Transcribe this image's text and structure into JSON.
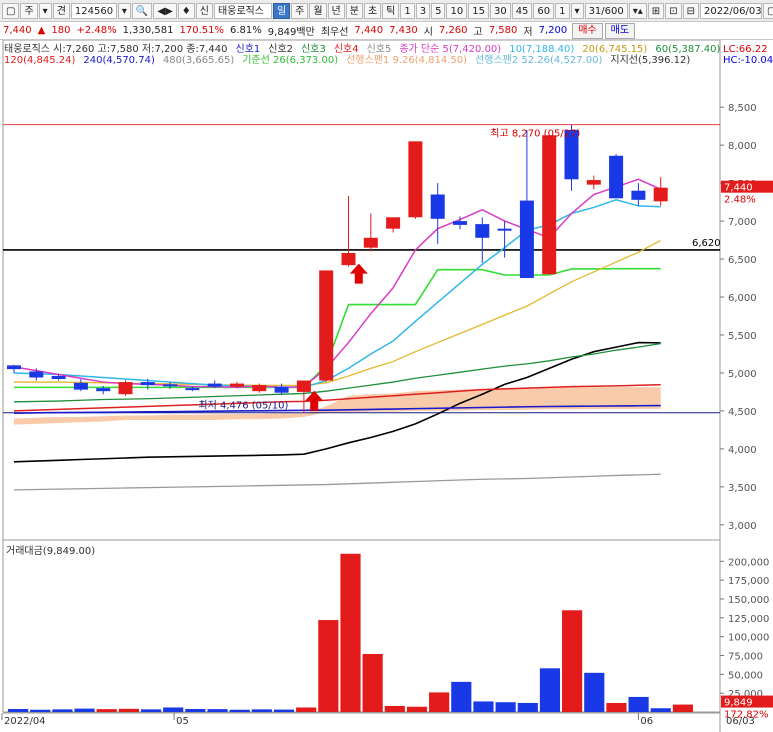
{
  "toolbar": {
    "items": [
      "▢",
      "주",
      "▾",
      "견",
      "124560",
      "▾",
      "🔍",
      "◀▶",
      "♦",
      "신",
      "태웅로직스",
      "일",
      "주",
      "월",
      "년",
      "분",
      "초",
      "틱",
      "1",
      "3",
      "5",
      "10",
      "15",
      "30",
      "45",
      "60",
      "1",
      "▾",
      "31/600",
      "▾▴",
      "⊞",
      "⊡",
      "⊟",
      "2022/06/03",
      "▢"
    ],
    "active": "일"
  },
  "quote": {
    "price": "7,440",
    "change_arrow": "▲",
    "change": "180",
    "change_pct": "+2.48%",
    "volume": "1,330,581",
    "vol_ratio": "170.51%",
    "turnover_pct": "6.81%",
    "amount_label": "9,849백만",
    "priority_label": "최우선",
    "ask": "7,440",
    "bid": "7,430",
    "open_label": "시",
    "open": "7,260",
    "high_label": "고",
    "high": "7,580",
    "low_label": "저",
    "low": "7,200",
    "buy_btn": "매수",
    "sell_btn": "매도"
  },
  "colors": {
    "up": "#e31b1b",
    "down": "#1a39e6",
    "ma5": "#d93cc3",
    "ma10": "#2fb7ea",
    "ma20": "#e3b82c",
    "ma60": "#1f8f3a",
    "ma120": "#e02020",
    "ma240": "#1a1acc",
    "ma480": "#9a9a9a",
    "kijun": "#33dd33",
    "cloud": "#f7b98f",
    "lagging": "#000000"
  },
  "legend": {
    "row1": [
      {
        "text": "태웅로직스 시:7,260 고:7,580 저:7,200 종:7,440",
        "color": "#333333"
      },
      {
        "text": "신호1",
        "color": "#1a1acc"
      },
      {
        "text": "신호2",
        "color": "#333333"
      },
      {
        "text": "신호3",
        "color": "#1f8f3a"
      },
      {
        "text": "신호4",
        "color": "#e31b1b"
      },
      {
        "text": "신호5",
        "color": "#888888"
      },
      {
        "text": "종가 단순 5(7,420.00)",
        "color": "#d93cc3"
      },
      {
        "text": "10(7,188.40)",
        "color": "#2fb7ea"
      },
      {
        "text": "20(6,745.15)",
        "color": "#c99a10"
      },
      {
        "text": "60(5,387.40)",
        "color": "#1f8f3a"
      }
    ],
    "row2": [
      {
        "text": "120(4,845.24)",
        "color": "#e31b1b"
      },
      {
        "text": "240(4,570.74)",
        "color": "#1a1acc"
      },
      {
        "text": "480(3,665.65)",
        "color": "#888888"
      },
      {
        "text": "기준선 26(6,373.00)",
        "color": "#33bb33"
      },
      {
        "text": "선행스팬1 9.26(4,814.50)",
        "color": "#f0a070"
      },
      {
        "text": "선행스팬2 52.26(4,527.00)",
        "color": "#66b8d8"
      },
      {
        "text": "지지선(5,396.12)",
        "color": "#333333"
      }
    ],
    "lc": "LC:66.22",
    "hc": "HC:-10.04"
  },
  "annotations": {
    "high": "최고 8,270 (05/27)",
    "low": "최저 4,476 (05/10)",
    "support_value": "6,620",
    "last_price": "7,440",
    "last_pct": "2.48%",
    "volume_title": "거래대금(9,849.00)",
    "volume_last": "9,849",
    "volume_pct": "172.82%",
    "date_end": "06/03"
  },
  "chart_data": {
    "type": "candlestick",
    "dates_visible": [
      "2022/04",
      "05",
      "06"
    ],
    "price_axis": {
      "ticks": [
        3000,
        3500,
        4000,
        4500,
        5000,
        5500,
        6000,
        6500,
        7000,
        7500,
        8000,
        8500
      ],
      "ylim": [
        2800,
        8700
      ]
    },
    "volume_axis": {
      "ticks": [
        25000,
        50000,
        75000,
        100000,
        125000,
        150000,
        175000,
        200000
      ],
      "ylim": [
        0,
        215000
      ]
    },
    "candles": [
      {
        "o": 5100,
        "h": 5110,
        "l": 5000,
        "c": 5050,
        "dir": "down"
      },
      {
        "o": 5020,
        "h": 5060,
        "l": 4900,
        "c": 4940,
        "dir": "down"
      },
      {
        "o": 4960,
        "h": 4990,
        "l": 4900,
        "c": 4920,
        "dir": "down"
      },
      {
        "o": 4870,
        "h": 4920,
        "l": 4760,
        "c": 4780,
        "dir": "down"
      },
      {
        "o": 4800,
        "h": 4830,
        "l": 4720,
        "c": 4760,
        "dir": "down"
      },
      {
        "o": 4720,
        "h": 4900,
        "l": 4700,
        "c": 4880,
        "dir": "up"
      },
      {
        "o": 4880,
        "h": 4920,
        "l": 4780,
        "c": 4840,
        "dir": "down"
      },
      {
        "o": 4850,
        "h": 4880,
        "l": 4790,
        "c": 4830,
        "dir": "down"
      },
      {
        "o": 4800,
        "h": 4820,
        "l": 4760,
        "c": 4780,
        "dir": "down"
      },
      {
        "o": 4860,
        "h": 4900,
        "l": 4800,
        "c": 4820,
        "dir": "down"
      },
      {
        "o": 4820,
        "h": 4880,
        "l": 4800,
        "c": 4860,
        "dir": "up"
      },
      {
        "o": 4760,
        "h": 4860,
        "l": 4740,
        "c": 4840,
        "dir": "up"
      },
      {
        "o": 4820,
        "h": 4860,
        "l": 4710,
        "c": 4740,
        "dir": "down"
      },
      {
        "o": 4750,
        "h": 4890,
        "l": 4476,
        "c": 4900,
        "dir": "up"
      },
      {
        "o": 4900,
        "h": 6350,
        "l": 4880,
        "c": 6350,
        "dir": "up"
      },
      {
        "o": 6420,
        "h": 7330,
        "l": 6400,
        "c": 6580,
        "dir": "up"
      },
      {
        "o": 6650,
        "h": 7100,
        "l": 6600,
        "c": 6780,
        "dir": "up"
      },
      {
        "o": 6900,
        "h": 7020,
        "l": 6850,
        "c": 7050,
        "dir": "up"
      },
      {
        "o": 7050,
        "h": 8050,
        "l": 7030,
        "c": 8050,
        "dir": "up"
      },
      {
        "o": 7350,
        "h": 7500,
        "l": 6700,
        "c": 7030,
        "dir": "down"
      },
      {
        "o": 7000,
        "h": 7060,
        "l": 6890,
        "c": 6950,
        "dir": "down"
      },
      {
        "o": 6960,
        "h": 7050,
        "l": 6450,
        "c": 6780,
        "dir": "down"
      },
      {
        "o": 6900,
        "h": 7000,
        "l": 6520,
        "c": 6900,
        "dir": "down"
      },
      {
        "o": 7270,
        "h": 8200,
        "l": 6250,
        "c": 6250,
        "dir": "down"
      },
      {
        "o": 6300,
        "h": 8130,
        "l": 6300,
        "c": 8130,
        "dir": "up"
      },
      {
        "o": 8200,
        "h": 8270,
        "l": 7400,
        "c": 7550,
        "dir": "down"
      },
      {
        "o": 7540,
        "h": 7600,
        "l": 7420,
        "c": 7480,
        "dir": "up"
      },
      {
        "o": 7860,
        "h": 7880,
        "l": 7300,
        "c": 7300,
        "dir": "down"
      },
      {
        "o": 7400,
        "h": 7500,
        "l": 7200,
        "c": 7280,
        "dir": "down"
      },
      {
        "o": 7260,
        "h": 7580,
        "l": 7200,
        "c": 7440,
        "dir": "up"
      }
    ],
    "volume": [
      {
        "v": 4000,
        "dir": "down"
      },
      {
        "v": 3000,
        "dir": "down"
      },
      {
        "v": 3500,
        "dir": "down"
      },
      {
        "v": 4500,
        "dir": "down"
      },
      {
        "v": 3800,
        "dir": "up"
      },
      {
        "v": 4200,
        "dir": "up"
      },
      {
        "v": 3500,
        "dir": "down"
      },
      {
        "v": 6000,
        "dir": "down"
      },
      {
        "v": 4000,
        "dir": "down"
      },
      {
        "v": 3800,
        "dir": "down"
      },
      {
        "v": 3000,
        "dir": "down"
      },
      {
        "v": 3500,
        "dir": "down"
      },
      {
        "v": 3200,
        "dir": "down"
      },
      {
        "v": 6000,
        "dir": "up"
      },
      {
        "v": 122000,
        "dir": "up"
      },
      {
        "v": 210000,
        "dir": "up"
      },
      {
        "v": 77000,
        "dir": "up"
      },
      {
        "v": 8000,
        "dir": "up"
      },
      {
        "v": 7000,
        "dir": "up"
      },
      {
        "v": 26000,
        "dir": "up"
      },
      {
        "v": 40000,
        "dir": "down"
      },
      {
        "v": 14000,
        "dir": "down"
      },
      {
        "v": 13000,
        "dir": "down"
      },
      {
        "v": 12000,
        "dir": "down"
      },
      {
        "v": 58000,
        "dir": "down"
      },
      {
        "v": 135000,
        "dir": "up"
      },
      {
        "v": 52000,
        "dir": "down"
      },
      {
        "v": 12000,
        "dir": "up"
      },
      {
        "v": 20000,
        "dir": "down"
      },
      {
        "v": 5000,
        "dir": "down"
      },
      {
        "v": 9849,
        "dir": "up"
      }
    ],
    "ma5": [
      5080,
      5030,
      4980,
      4930,
      4880,
      4860,
      4850,
      4840,
      4820,
      4820,
      4810,
      4830,
      4810,
      4820,
      5060,
      5400,
      5780,
      6120,
      6620,
      6900,
      7020,
      7150,
      7000,
      6890,
      6780,
      7100,
      7350,
      7450,
      7550,
      7420
    ],
    "ma10": [
      5000,
      4990,
      4980,
      4960,
      4940,
      4920,
      4900,
      4880,
      4860,
      4840,
      4830,
      4820,
      4810,
      4810,
      4900,
      5060,
      5250,
      5420,
      5680,
      5930,
      6180,
      6430,
      6650,
      6880,
      6950,
      7100,
      7180,
      7280,
      7200,
      7188
    ],
    "ma20": [
      4880,
      4880,
      4880,
      4875,
      4870,
      4865,
      4860,
      4855,
      4850,
      4845,
      4840,
      4838,
      4836,
      4835,
      4870,
      4960,
      5060,
      5150,
      5280,
      5400,
      5520,
      5640,
      5760,
      5880,
      6040,
      6200,
      6330,
      6460,
      6590,
      6745
    ],
    "ma60": [
      4620,
      4625,
      4630,
      4640,
      4650,
      4655,
      4660,
      4670,
      4680,
      4690,
      4700,
      4710,
      4720,
      4730,
      4760,
      4800,
      4840,
      4880,
      4930,
      4970,
      5010,
      5050,
      5090,
      5120,
      5160,
      5210,
      5250,
      5300,
      5340,
      5387
    ],
    "ma120": [
      4500,
      4510,
      4520,
      4530,
      4540,
      4550,
      4560,
      4570,
      4580,
      4590,
      4600,
      4610,
      4620,
      4625,
      4640,
      4660,
      4680,
      4700,
      4720,
      4740,
      4760,
      4780,
      4790,
      4800,
      4810,
      4820,
      4825,
      4830,
      4838,
      4845
    ],
    "ma240": [
      4470,
      4475,
      4478,
      4480,
      4482,
      4485,
      4488,
      4490,
      4493,
      4496,
      4500,
      4502,
      4505,
      4508,
      4510,
      4515,
      4520,
      4525,
      4530,
      4535,
      4540,
      4545,
      4550,
      4555,
      4558,
      4560,
      4563,
      4566,
      4568,
      4571
    ],
    "ma480": [
      3460,
      3465,
      3470,
      3475,
      3480,
      3485,
      3490,
      3495,
      3500,
      3505,
      3510,
      3515,
      3520,
      3525,
      3530,
      3540,
      3550,
      3560,
      3570,
      3580,
      3590,
      3600,
      3605,
      3610,
      3620,
      3630,
      3640,
      3650,
      3658,
      3666
    ],
    "kijun": [
      4810,
      4810,
      4810,
      4810,
      4810,
      4810,
      4810,
      4810,
      4810,
      4810,
      4810,
      4810,
      4810,
      4810,
      5100,
      5900,
      5900,
      5900,
      5900,
      6360,
      6360,
      6360,
      6290,
      6290,
      6290,
      6370,
      6370,
      6373,
      6373,
      6373
    ],
    "lagging": [
      3830,
      3840,
      3850,
      3860,
      3870,
      3880,
      3890,
      3895,
      3900,
      3905,
      3910,
      3915,
      3920,
      3930,
      4000,
      4080,
      4150,
      4230,
      4330,
      4460,
      4600,
      4720,
      4850,
      4940,
      5060,
      5180,
      5280,
      5340,
      5400,
      5396
    ],
    "span1": [
      4320,
      4330,
      4340,
      4350,
      4360,
      4380,
      4380,
      4380,
      4380,
      4380,
      4390,
      4390,
      4400,
      4420,
      4560,
      4700,
      4720,
      4730,
      4760,
      4770,
      4780,
      4790,
      4800,
      4805,
      4810,
      4812,
      4813,
      4814,
      4814,
      4814
    ],
    "span2": [
      4400,
      4410,
      4420,
      4420,
      4430,
      4440,
      4440,
      4450,
      4450,
      4455,
      4460,
      4460,
      4470,
      4470,
      4480,
      4480,
      4490,
      4490,
      4500,
      4500,
      4505,
      4510,
      4510,
      4515,
      4520,
      4520,
      4523,
      4525,
      4526,
      4527
    ],
    "support_level": 6620,
    "resist_level": 8270,
    "low_level": 4476
  }
}
